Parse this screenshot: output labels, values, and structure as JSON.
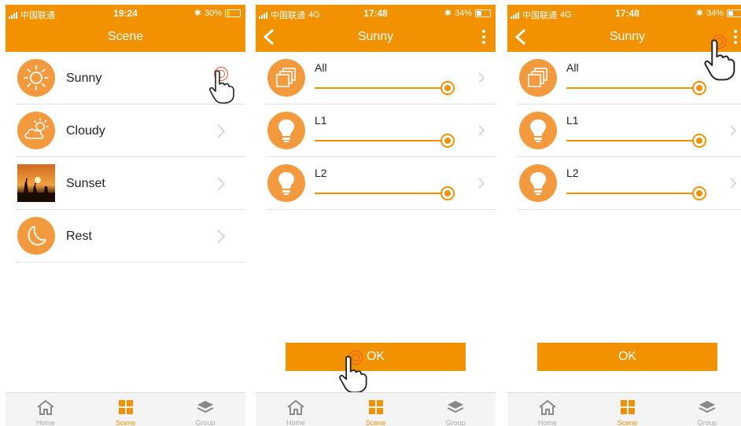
{
  "screens": [
    {
      "status": {
        "carrier": "中国联通",
        "network": "",
        "time": "19:24",
        "battery": "30%"
      },
      "title": "Scene",
      "scenes": [
        {
          "label": "Sunny",
          "icon": "sun-icon"
        },
        {
          "label": "Cloudy",
          "icon": "cloud-sun-icon"
        },
        {
          "label": "Sunset",
          "icon": "sunset-photo"
        },
        {
          "label": "Rest",
          "icon": "moon-icon"
        }
      ]
    },
    {
      "status": {
        "carrier": "中国联通",
        "network": "4G",
        "time": "17:48",
        "battery": "34%"
      },
      "title": "Sunny",
      "lights": [
        {
          "label": "All",
          "icon": "layers-icon",
          "level": 1.0
        },
        {
          "label": "L1",
          "icon": "bulb-icon",
          "level": 1.0
        },
        {
          "label": "L2",
          "icon": "bulb-icon",
          "level": 1.0
        }
      ],
      "ok_label": "OK"
    },
    {
      "status": {
        "carrier": "中国联通",
        "network": "4G",
        "time": "17:48",
        "battery": "34%"
      },
      "title": "Sunny",
      "lights": [
        {
          "label": "All",
          "icon": "layers-icon",
          "level": 1.0
        },
        {
          "label": "L1",
          "icon": "bulb-icon",
          "level": 1.0
        },
        {
          "label": "L2",
          "icon": "bulb-icon",
          "level": 1.0
        }
      ],
      "ok_label": "OK"
    }
  ],
  "tabs": [
    {
      "label": "Home",
      "icon": "home-icon"
    },
    {
      "label": "Scene",
      "icon": "scene-grid-icon"
    },
    {
      "label": "Group",
      "icon": "layers-stack-icon"
    }
  ],
  "colors": {
    "accent": "#f39200",
    "divider": "#e1e1e1",
    "tab_inactive": "#aaaaaa"
  }
}
